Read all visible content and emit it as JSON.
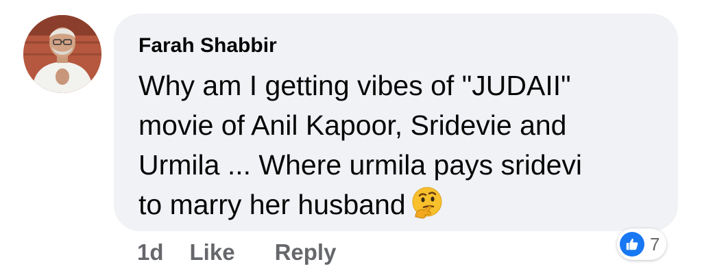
{
  "comment": {
    "author": "Farah Shabbir",
    "body_lines": [
      "Why am I getting vibes of \"JUDAII\"",
      "movie of Anil Kapoor, Sridevie and",
      "Urmila ... Where urmila pays sridevi",
      "to marry her husband"
    ],
    "emoji": "thinking-face-icon",
    "timestamp": "1d",
    "like_label": "Like",
    "reply_label": "Reply",
    "reaction_count": "7"
  },
  "colors": {
    "bubble_bg": "#f0f2f5",
    "text": "#050505",
    "secondary_text": "#65676b",
    "like_blue": "#1877f2"
  }
}
